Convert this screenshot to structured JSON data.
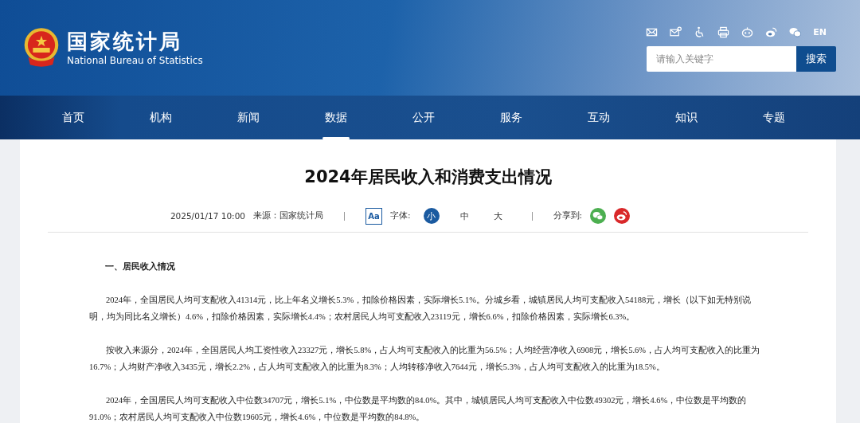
{
  "header": {
    "title": "国家统计局",
    "subtitle": "National Bureau of Statistics"
  },
  "toolbar": {
    "language": "EN"
  },
  "search": {
    "placeholder": "请输入关键字",
    "button": "搜索"
  },
  "nav": [
    {
      "label": "首页",
      "selected": false
    },
    {
      "label": "机构",
      "selected": false
    },
    {
      "label": "新闻",
      "selected": false
    },
    {
      "label": "数据",
      "selected": true
    },
    {
      "label": "公开",
      "selected": false
    },
    {
      "label": "服务",
      "selected": false
    },
    {
      "label": "互动",
      "selected": false
    },
    {
      "label": "知识",
      "selected": false
    },
    {
      "label": "专题",
      "selected": false
    }
  ],
  "article": {
    "title": "2024年居民收入和消费支出情况",
    "date": "2025/01/17 10:00",
    "source": "来源：国家统计局",
    "font_button": "Aa",
    "font_label": "字体:",
    "font_sizes": [
      {
        "label": "小",
        "selected": true
      },
      {
        "label": "中",
        "selected": false
      },
      {
        "label": "大",
        "selected": false
      }
    ],
    "share_label": "分享到:"
  },
  "section_heading": "一、居民收入情况",
  "paragraphs": [
    "2024年，全国居民人均可支配收入41314元，比上年名义增长5.3%，扣除价格因素，实际增长5.1%。分城乡看，城镇居民人均可支配收入54188元，增长（以下如无特别说明，均为同比名义增长）4.6%，扣除价格因素，实际增长4.4%；农村居民人均可支配收入23119元，增长6.6%，扣除价格因素，实际增长6.3%。",
    "按收入来源分，2024年，全国居民人均工资性收入23327元，增长5.8%，占人均可支配收入的比重为56.5%；人均经营净收入6908元，增长5.6%，占人均可支配收入的比重为16.7%；人均财产净收入3435元，增长2.2%，占人均可支配收入的比重为8.3%；人均转移净收入7644元，增长5.3%，占人均可支配收入的比重为18.5%。",
    "2024年，全国居民人均可支配收入中位数34707元，增长5.1%，中位数是平均数的84.0%。其中，城镇居民人均可支配收入中位数49302元，增长4.6%，中位数是平均数的91.0%；农村居民人均可支配收入中位数19605元，增长4.6%，中位数是平均数的84.8%。"
  ]
}
